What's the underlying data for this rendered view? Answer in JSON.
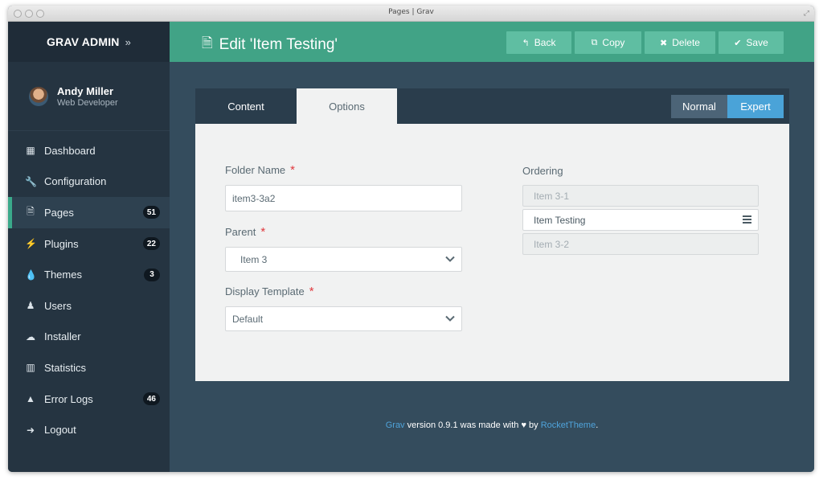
{
  "window": {
    "title": "Pages | Grav"
  },
  "sidebar": {
    "brand": "GRAV ADMIN",
    "brand_chevron": "»",
    "user": {
      "name": "Andy Miller",
      "role": "Web Developer"
    },
    "items": [
      {
        "label": "Dashboard",
        "icon": "th-icon",
        "glyph": "▦",
        "badge": ""
      },
      {
        "label": "Configuration",
        "icon": "wrench-icon",
        "glyph": "🔧",
        "badge": ""
      },
      {
        "label": "Pages",
        "icon": "file-icon",
        "glyph": "🗎",
        "badge": "51",
        "active": true
      },
      {
        "label": "Plugins",
        "icon": "plug-icon",
        "glyph": "⚡",
        "badge": "22"
      },
      {
        "label": "Themes",
        "icon": "tint-icon",
        "glyph": "💧",
        "badge": "3"
      },
      {
        "label": "Users",
        "icon": "user-icon",
        "glyph": "♟",
        "badge": ""
      },
      {
        "label": "Installer",
        "icon": "cloud-download-icon",
        "glyph": "☁",
        "badge": ""
      },
      {
        "label": "Statistics",
        "icon": "bar-chart-icon",
        "glyph": "▥",
        "badge": ""
      },
      {
        "label": "Error Logs",
        "icon": "warning-icon",
        "glyph": "▲",
        "badge": "46"
      },
      {
        "label": "Logout",
        "icon": "sign-out-icon",
        "glyph": "➜",
        "badge": ""
      }
    ]
  },
  "header": {
    "title": "Edit 'Item Testing'",
    "buttons": {
      "back": "Back",
      "copy": "Copy",
      "delete": "Delete",
      "save": "Save"
    }
  },
  "tabs": {
    "content": "Content",
    "options": "Options"
  },
  "modes": {
    "normal": "Normal",
    "expert": "Expert",
    "selected": "Expert"
  },
  "form": {
    "folder_label": "Folder Name",
    "folder_value": "item3-3a2",
    "parent_label": "Parent",
    "parent_value": "Item 3",
    "template_label": "Display Template",
    "template_value": "Default",
    "required_mark": "*",
    "ordering_label": "Ordering",
    "ordering": [
      "Item 3-1",
      "Item Testing",
      "Item 3-2"
    ]
  },
  "footer": {
    "grav": "Grav",
    "text1": " version 0.9.1 was made with ",
    "text2": " by ",
    "rockettheme": "RocketTheme",
    "end": "."
  },
  "colors": {
    "accent": "#41a386",
    "sidebar": "#253441",
    "expert": "#4aa3d8",
    "danger": "#e0393e"
  }
}
